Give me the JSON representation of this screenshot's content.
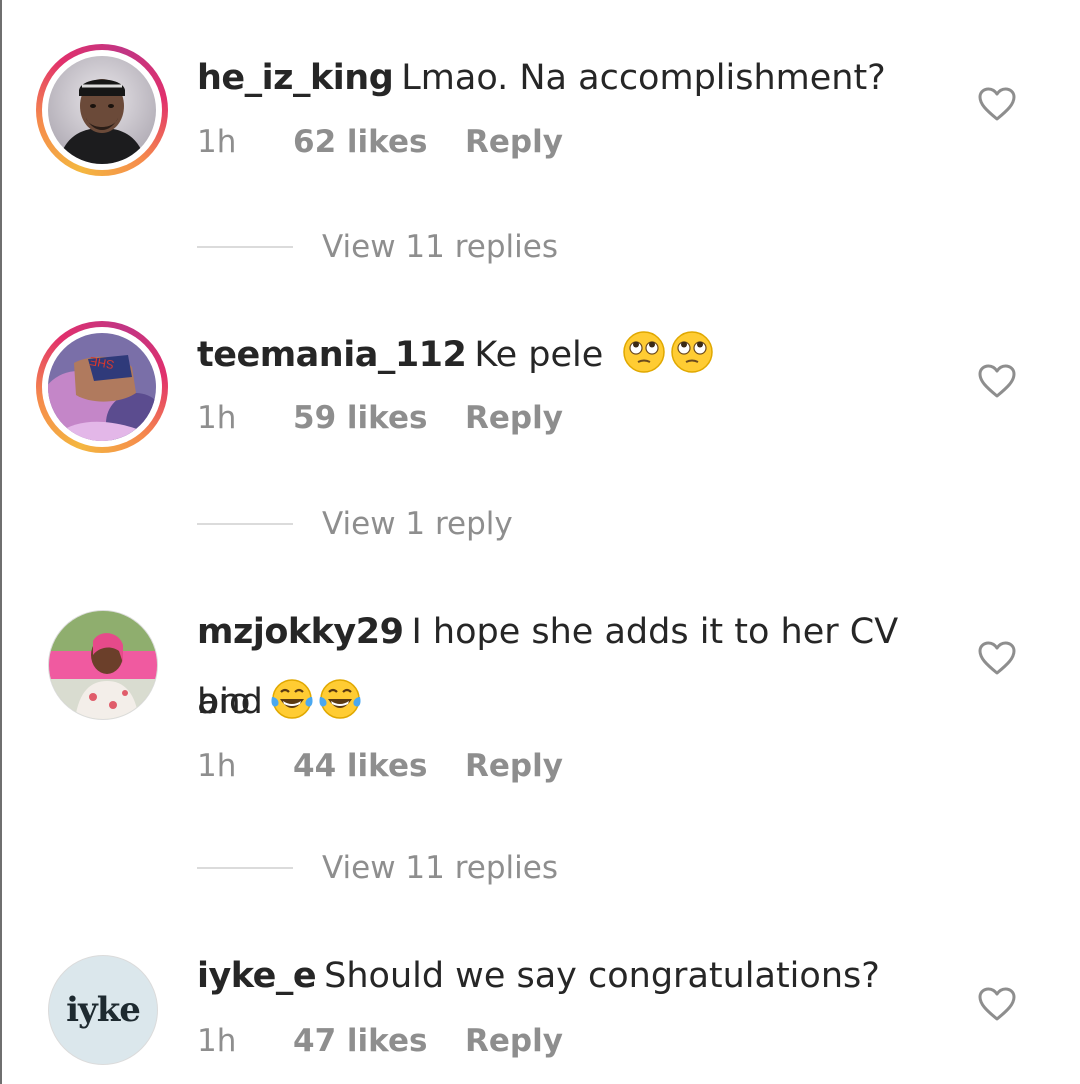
{
  "comments": [
    {
      "username": "he_iz_king",
      "text": "Lmao. Na accomplishment?",
      "text_cont": "",
      "emoji": [],
      "time": "1h",
      "likes": "62 likes",
      "reply_label": "Reply",
      "view_replies": "View 11 replies",
      "avatar_story_ring": true,
      "avatar_icon": "man-photo-icon"
    },
    {
      "username": "teemania_112",
      "text": "Ke pele",
      "text_cont": "",
      "emoji": [
        "eye-roll-emoji",
        "eye-roll-emoji"
      ],
      "time": "1h",
      "likes": "59 likes",
      "reply_label": "Reply",
      "view_replies": "View 1 reply",
      "avatar_story_ring": true,
      "avatar_icon": "woman-photo-icon"
    },
    {
      "username": "mzjokky29",
      "text": "I hope she adds it to her CV and",
      "text_cont": "bio",
      "emoji": [
        "tears-of-joy-emoji",
        "tears-of-joy-emoji"
      ],
      "time": "1h",
      "likes": "44 likes",
      "reply_label": "Reply",
      "view_replies": "View 11 replies",
      "avatar_story_ring": false,
      "avatar_icon": "woman-pink-photo-icon"
    },
    {
      "username": "iyke_e",
      "text": "Should we say congratulations?",
      "text_cont": "",
      "emoji": [],
      "time": "1h",
      "likes": "47 likes",
      "reply_label": "Reply",
      "view_replies": "",
      "avatar_story_ring": false,
      "avatar_icon": "iyke-logo-icon",
      "avatar_logo_text": "iyke"
    }
  ],
  "colors": {
    "text": "#262626",
    "muted": "#8e8e8e",
    "divider": "#dbdbdb",
    "story_ring": [
      "#f4b740",
      "#e1306c",
      "#c13584"
    ]
  }
}
